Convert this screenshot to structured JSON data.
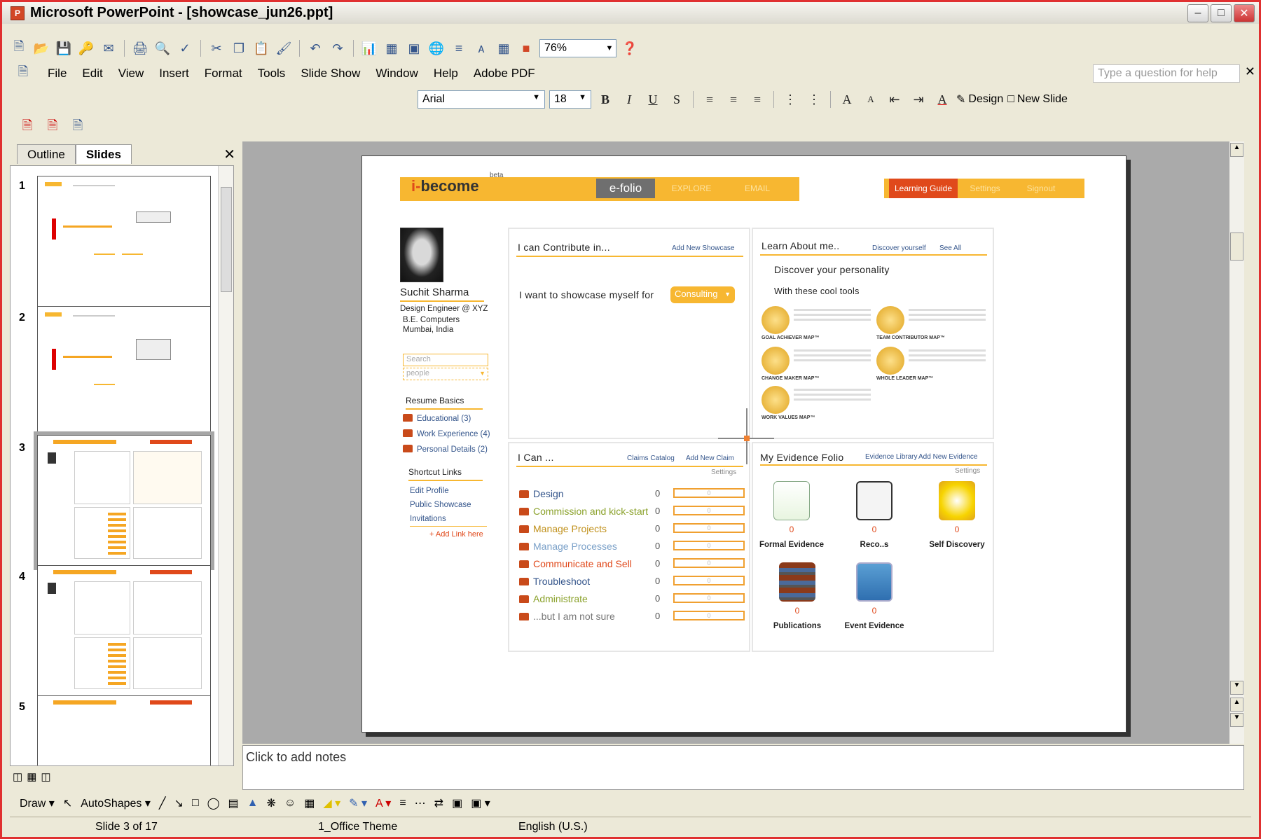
{
  "window": {
    "title": "Microsoft PowerPoint - [showcase_jun26.ppt]"
  },
  "menu": [
    "File",
    "Edit",
    "View",
    "Insert",
    "Format",
    "Tools",
    "Slide Show",
    "Window",
    "Help",
    "Adobe PDF"
  ],
  "toolbar": {
    "zoom": "76%"
  },
  "help_placeholder": "Type a question for help",
  "format": {
    "font": "Arial",
    "size": "18",
    "design": "Design",
    "new_slide": "New Slide"
  },
  "left_pane": {
    "tabs": [
      "Outline",
      "Slides"
    ],
    "thumb_numbers": [
      "1",
      "2",
      "3",
      "4",
      "5"
    ]
  },
  "slide": {
    "logo_prefix": "i-",
    "logo_suffix": "become",
    "beta": "beta",
    "tabs": {
      "efolio": "e-folio",
      "explore": "EXPLORE",
      "email": "EMAIL",
      "learning_guide": "Learning Guide",
      "settings": "Settings",
      "signout": "Signout"
    },
    "profile": {
      "name": "Suchit Sharma",
      "role": "Design Engineer @ XYZ",
      "degree": "B.E. Computers",
      "location": "Mumbai, India",
      "search_placeholder": "Search",
      "people_placeholder": "people"
    },
    "resume": {
      "title": "Resume Basics",
      "items": [
        "Educational  (3)",
        "Work Experience (4)",
        "Personal Details (2)"
      ]
    },
    "shortcuts": {
      "title": "Shortcut Links",
      "items": [
        "Edit Profile",
        "Public Showcase",
        "Invitations"
      ],
      "add": "+ Add Link here"
    },
    "contribute": {
      "title": "I can Contribute in...",
      "add": "Add New Showcase",
      "prompt": "I want to showcase myself for",
      "selected": "Consulting"
    },
    "learn": {
      "title": "Learn About me..",
      "link1": "Discover yourself",
      "link2": "See All",
      "heading": "Discover your personality",
      "sub": "With these cool tools",
      "tools": [
        "GOAL ACHIEVER MAP™",
        "TEAM CONTRIBUTOR MAP™",
        "CHANGE MAKER MAP™",
        "WHOLE LEADER MAP™",
        "WORK VALUES MAP™"
      ]
    },
    "ican": {
      "title": "I Can ...",
      "link1": "Claims Catalog",
      "link2": "Add New Claim",
      "settings": "Settings",
      "claims": [
        {
          "label": "Design",
          "count": "0",
          "bar": "0",
          "color": "#34558b"
        },
        {
          "label": "Commission and kick-start",
          "count": "0",
          "bar": "0",
          "color": "#8aa12a"
        },
        {
          "label": "Manage Projects",
          "count": "0",
          "bar": "0",
          "color": "#c0901a"
        },
        {
          "label": "Manage  Processes",
          "count": "0",
          "bar": "0",
          "color": "#7aa0c8"
        },
        {
          "label": "Communicate and Sell",
          "count": "0",
          "bar": "0",
          "color": "#e0491b"
        },
        {
          "label": "Troubleshoot",
          "count": "0",
          "bar": "0",
          "color": "#34558b"
        },
        {
          "label": "Administrate",
          "count": "0",
          "bar": "0",
          "color": "#8aa12a"
        },
        {
          "label": "...but I am not sure",
          "count": "0",
          "bar": "0",
          "color": "#777"
        }
      ]
    },
    "evidence": {
      "title": "My Evidence Folio",
      "link1": "Evidence Library",
      "link2": "Add New Evidence",
      "settings": "Settings",
      "items": [
        {
          "label": "Formal Evidence",
          "count": "0",
          "icon": "document-icon"
        },
        {
          "label": "Reco..s",
          "count": "0",
          "icon": "speech-bubble-icon"
        },
        {
          "label": "Self Discovery",
          "count": "0",
          "icon": "lightbulb-icon"
        },
        {
          "label": "Publications",
          "count": "0",
          "icon": "books-icon"
        },
        {
          "label": "Event Evidence",
          "count": "0",
          "icon": "picture-icon"
        }
      ]
    }
  },
  "notes_placeholder": "Click to add notes",
  "draw": {
    "draw": "Draw",
    "autoshapes": "AutoShapes"
  },
  "status": {
    "slide": "Slide 3 of 17",
    "theme": "1_Office Theme",
    "lang": "English (U.S.)"
  }
}
